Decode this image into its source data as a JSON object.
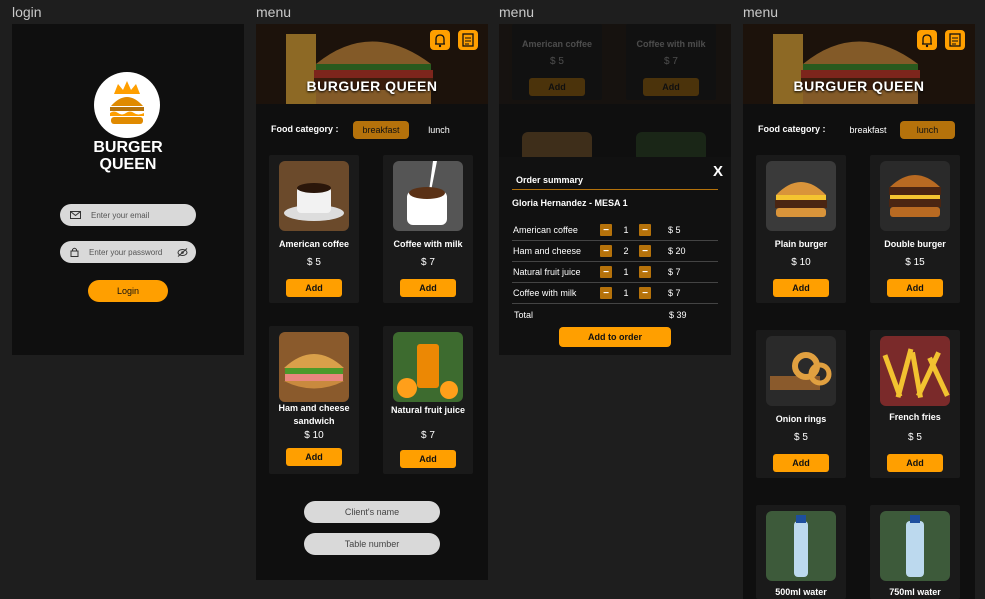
{
  "frames": {
    "login_label": "login",
    "menu1_label": "menu",
    "menu2_label": "menu",
    "menu3_label": "menu"
  },
  "brand": {
    "line1": "BURGER",
    "line2": "QUEEN",
    "hero_title": "BURGUER QUEEN"
  },
  "login": {
    "email_placeholder": "Enter your email",
    "password_placeholder": "Enter your password",
    "button": "Login"
  },
  "category": {
    "label": "Food category :",
    "breakfast": "breakfast",
    "lunch": "lunch"
  },
  "breakfast_items": [
    {
      "name": "American coffee",
      "price": "$ 5",
      "add": "Add"
    },
    {
      "name": "Coffee with milk",
      "price": "$ 7",
      "add": "Add"
    },
    {
      "name": "Ham and cheese sandwich",
      "price": "$ 10",
      "add": "Add"
    },
    {
      "name": "Natural fruit juice",
      "price": "$ 7",
      "add": "Add"
    }
  ],
  "client_inputs": {
    "name": "Client's name",
    "table": "Table number"
  },
  "order": {
    "close": "X",
    "title": "Order summary",
    "client": "Gloria Hernandez - MESA 1",
    "minus": "−",
    "plus": "−",
    "rows": [
      {
        "item": "American coffee",
        "qty": "1",
        "subtotal": "$ 5"
      },
      {
        "item": "Ham and cheese",
        "qty": "2",
        "subtotal": "$ 20"
      },
      {
        "item": "Natural fruit juice",
        "qty": "1",
        "subtotal": "$ 7"
      },
      {
        "item": "Coffee with milk",
        "qty": "1",
        "subtotal": "$ 7"
      }
    ],
    "total_label": "Total",
    "total_value": "$ 39",
    "add_button": "Add to order"
  },
  "lunch_items": [
    {
      "name": "Plain burger",
      "price": "$ 10",
      "add": "Add"
    },
    {
      "name": "Double burger",
      "price": "$ 15",
      "add": "Add"
    },
    {
      "name": "Onion rings",
      "price": "$ 5",
      "add": "Add"
    },
    {
      "name": "French fries",
      "price": "$ 5",
      "add": "Add"
    },
    {
      "name": "500ml water",
      "price": "",
      "add": ""
    },
    {
      "name": "750ml water",
      "price": "",
      "add": ""
    }
  ],
  "colors": {
    "accent": "#ff9f00",
    "accent_dark": "#b5720b",
    "panel": "#0f0f0f",
    "canvas": "#1e1e1e"
  },
  "icons": [
    "envelope-icon",
    "lock-icon",
    "eye-slash-icon",
    "bell-icon",
    "notepad-icon",
    "crown-icon",
    "burger-logo-icon"
  ]
}
